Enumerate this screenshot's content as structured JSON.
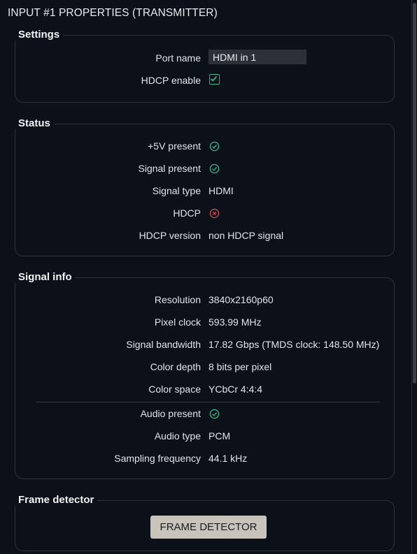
{
  "panel": {
    "title": "INPUT #1 PROPERTIES (TRANSMITTER)"
  },
  "settings": {
    "title": "Settings",
    "port_name_label": "Port name",
    "port_name_value": "HDMI in 1",
    "hdcp_enable_label": "HDCP enable",
    "hdcp_enable_checked": true
  },
  "status": {
    "title": "Status",
    "five_v_label": "+5V present",
    "five_v_state": "ok",
    "signal_present_label": "Signal present",
    "signal_present_state": "ok",
    "signal_type_label": "Signal type",
    "signal_type_value": "HDMI",
    "hdcp_label": "HDCP",
    "hdcp_state": "error",
    "hdcp_version_label": "HDCP version",
    "hdcp_version_value": "non HDCP signal"
  },
  "signal_info": {
    "title": "Signal info",
    "resolution_label": "Resolution",
    "resolution_value": "3840x2160p60",
    "pixel_clock_label": "Pixel clock",
    "pixel_clock_value": "593.99 MHz",
    "bandwidth_label": "Signal bandwidth",
    "bandwidth_value": "17.82 Gbps (TMDS clock: 148.50 MHz)",
    "color_depth_label": "Color depth",
    "color_depth_value": "8 bits per pixel",
    "color_space_label": "Color space",
    "color_space_value": "YCbCr 4:4:4",
    "audio_present_label": "Audio present",
    "audio_present_state": "ok",
    "audio_type_label": "Audio type",
    "audio_type_value": "PCM",
    "sampling_label": "Sampling frequency",
    "sampling_value": "44.1 kHz"
  },
  "frame_detector": {
    "title": "Frame detector",
    "button_label": "FRAME DETECTOR"
  },
  "colors": {
    "ok": "#2fb88a",
    "error": "#e0464b",
    "button_bg": "#c8c4bc"
  }
}
